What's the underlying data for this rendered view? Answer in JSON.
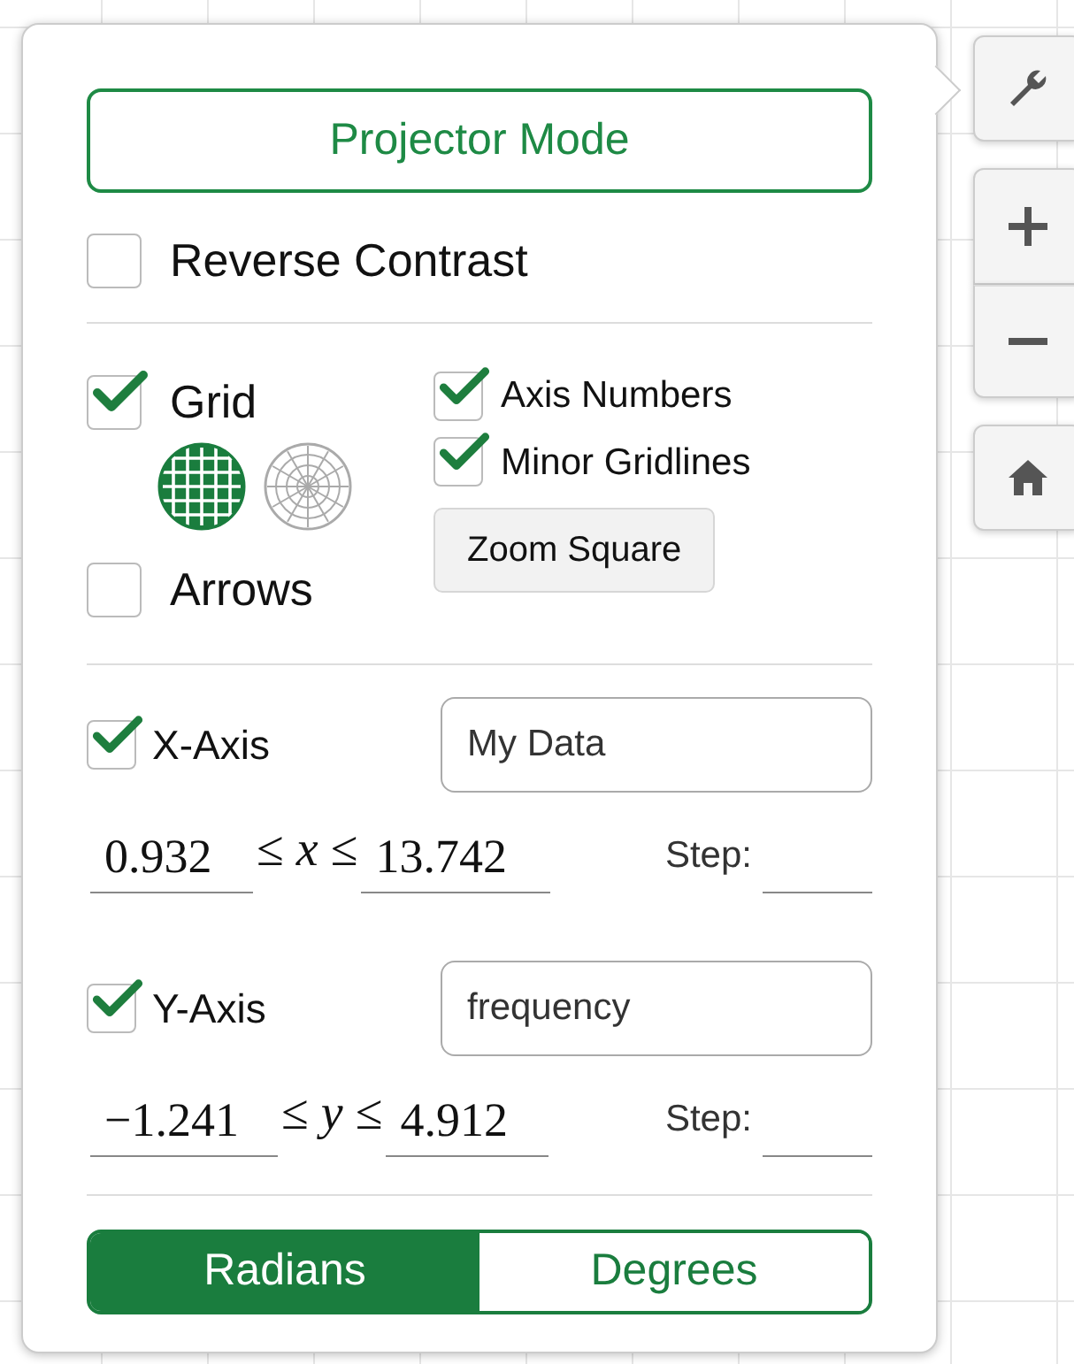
{
  "projector_mode_button": {
    "label": "Projector Mode"
  },
  "reverse_contrast": {
    "label": "Reverse Contrast",
    "checked": false
  },
  "grid": {
    "label": "Grid",
    "checked": true
  },
  "grid_types": [
    {
      "kind": "cartesian",
      "selected": true
    },
    {
      "kind": "polar",
      "selected": false
    }
  ],
  "arrows": {
    "label": "Arrows",
    "checked": false
  },
  "axis_numbers": {
    "label": "Axis Numbers",
    "checked": true
  },
  "minor_gridlines": {
    "label": "Minor Gridlines",
    "checked": true
  },
  "zoom_square_button": {
    "label": "Zoom Square"
  },
  "axes": [
    {
      "label": "X-Axis",
      "checked": true,
      "axis_label_value": "My Data",
      "min": "0.932",
      "relation": "≤ *x* ≤",
      "max": "13.742",
      "step_label": "Step:"
    },
    {
      "label": "Y-Axis",
      "checked": true,
      "axis_label_value": "frequency",
      "min": "−1.241",
      "relation": "≤ *y* ≤",
      "max": "4.912",
      "step_label": "Step:"
    }
  ],
  "angle_modes": [
    {
      "label": "Radians",
      "selected": true
    },
    {
      "label": "Degrees",
      "selected": false
    }
  ],
  "toolbar": [
    {
      "kind": "wrench"
    },
    {
      "kind": "plus"
    },
    {
      "kind": "minus"
    },
    {
      "kind": "home"
    }
  ]
}
